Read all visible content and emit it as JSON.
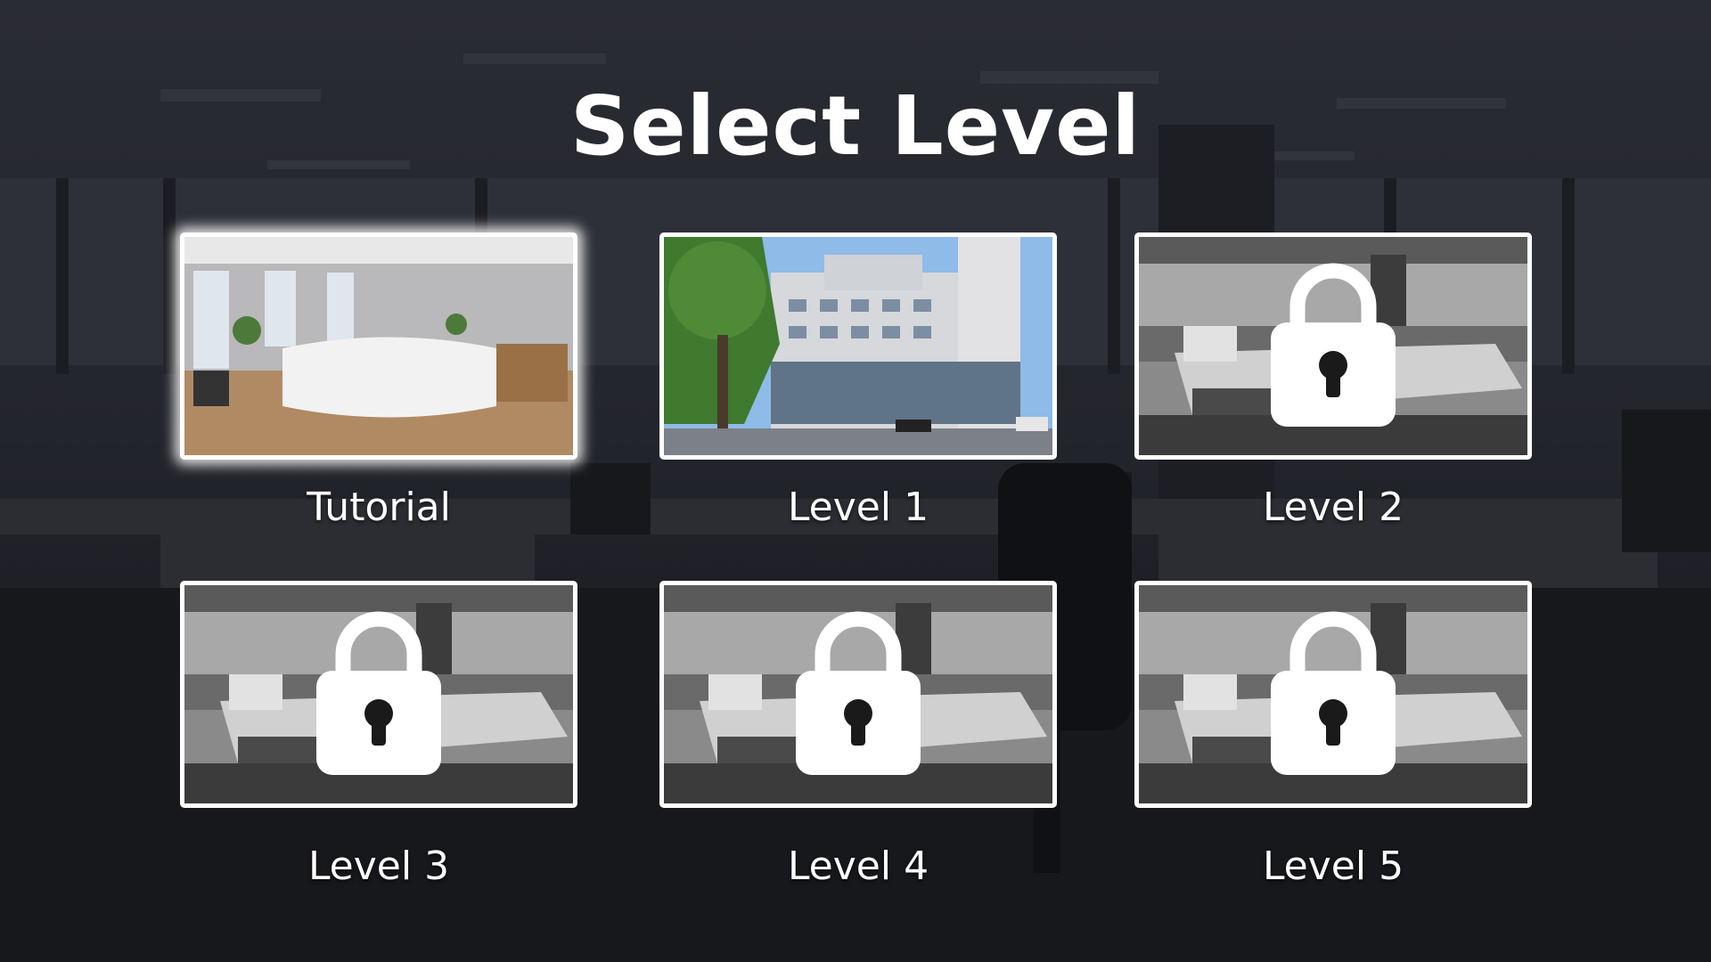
{
  "screen": {
    "title": "Select Level"
  },
  "levels": [
    {
      "label": "Tutorial",
      "locked": false,
      "selected": true,
      "thumbnail": "reception-lobby"
    },
    {
      "label": "Level 1",
      "locked": false,
      "selected": false,
      "thumbnail": "office-building-exterior"
    },
    {
      "label": "Level 2",
      "locked": true,
      "selected": false,
      "thumbnail": "office-cubicles-grayscale"
    },
    {
      "label": "Level 3",
      "locked": true,
      "selected": false,
      "thumbnail": "office-cubicles-grayscale"
    },
    {
      "label": "Level 4",
      "locked": true,
      "selected": false,
      "thumbnail": "office-cubicles-grayscale"
    },
    {
      "label": "Level 5",
      "locked": true,
      "selected": false,
      "thumbnail": "office-cubicles-grayscale"
    }
  ],
  "icons": {
    "locked": "padlock-icon"
  },
  "colors": {
    "frame": "#ffffff",
    "text": "#ffffff",
    "background": "#1b1c22"
  }
}
